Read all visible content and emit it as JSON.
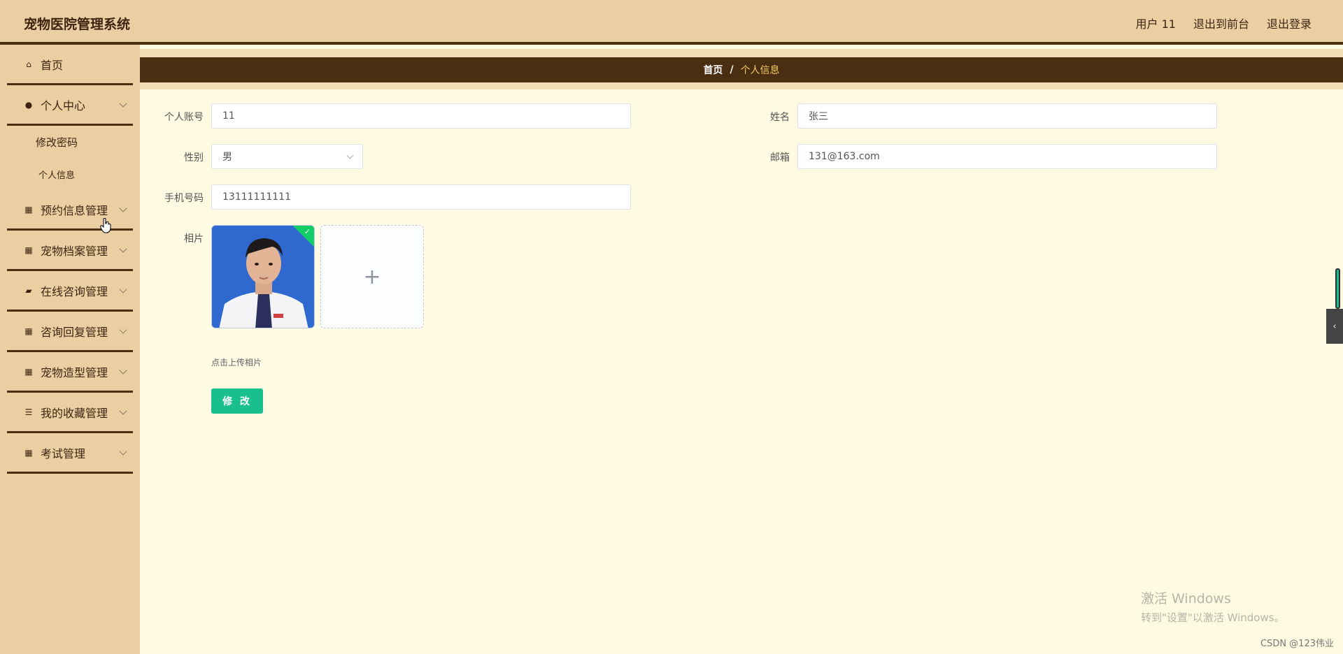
{
  "header": {
    "app_title": "宠物医院管理系统",
    "user": "用户 11",
    "to_front": "退出到前台",
    "logout": "退出登录"
  },
  "sidebar": {
    "items": [
      {
        "label": "首页",
        "icon": "home-icon"
      },
      {
        "label": "个人中心",
        "icon": "user-icon",
        "expanded": true,
        "children": [
          {
            "label": "修改密码"
          },
          {
            "label": "个人信息"
          }
        ]
      },
      {
        "label": "预约信息管理",
        "icon": "grid-icon"
      },
      {
        "label": "宠物档案管理",
        "icon": "grid-icon"
      },
      {
        "label": "在线咨询管理",
        "icon": "briefcase-icon"
      },
      {
        "label": "咨询回复管理",
        "icon": "grid-icon"
      },
      {
        "label": "宠物造型管理",
        "icon": "grid-icon"
      },
      {
        "label": "我的收藏管理",
        "icon": "list-icon"
      },
      {
        "label": "考试管理",
        "icon": "apps-icon"
      }
    ]
  },
  "breadcrumb": {
    "home": "首页",
    "separator": "/",
    "current": "个人信息"
  },
  "form": {
    "account_label": "个人账号",
    "account_value": "11",
    "name_label": "姓名",
    "name_value": "张三",
    "gender_label": "性别",
    "gender_value": "男",
    "email_label": "邮箱",
    "email_value": "131@163.com",
    "phone_label": "手机号码",
    "phone_value": "13111111111",
    "photo_label": "相片",
    "upload_tip": "点击上传相片",
    "submit_label": "修 改"
  },
  "watermark": {
    "line1": "激活 Windows",
    "line2": "转到\"设置\"以激活 Windows。"
  },
  "csdn": "CSDN @123伟业",
  "colors": {
    "header_bg": "#ebcfa3",
    "dark_brown": "#4a2e12",
    "content_bg": "#fefbe2",
    "accent_green": "#19c08e",
    "breadcrumb_current": "#f5c95f"
  }
}
